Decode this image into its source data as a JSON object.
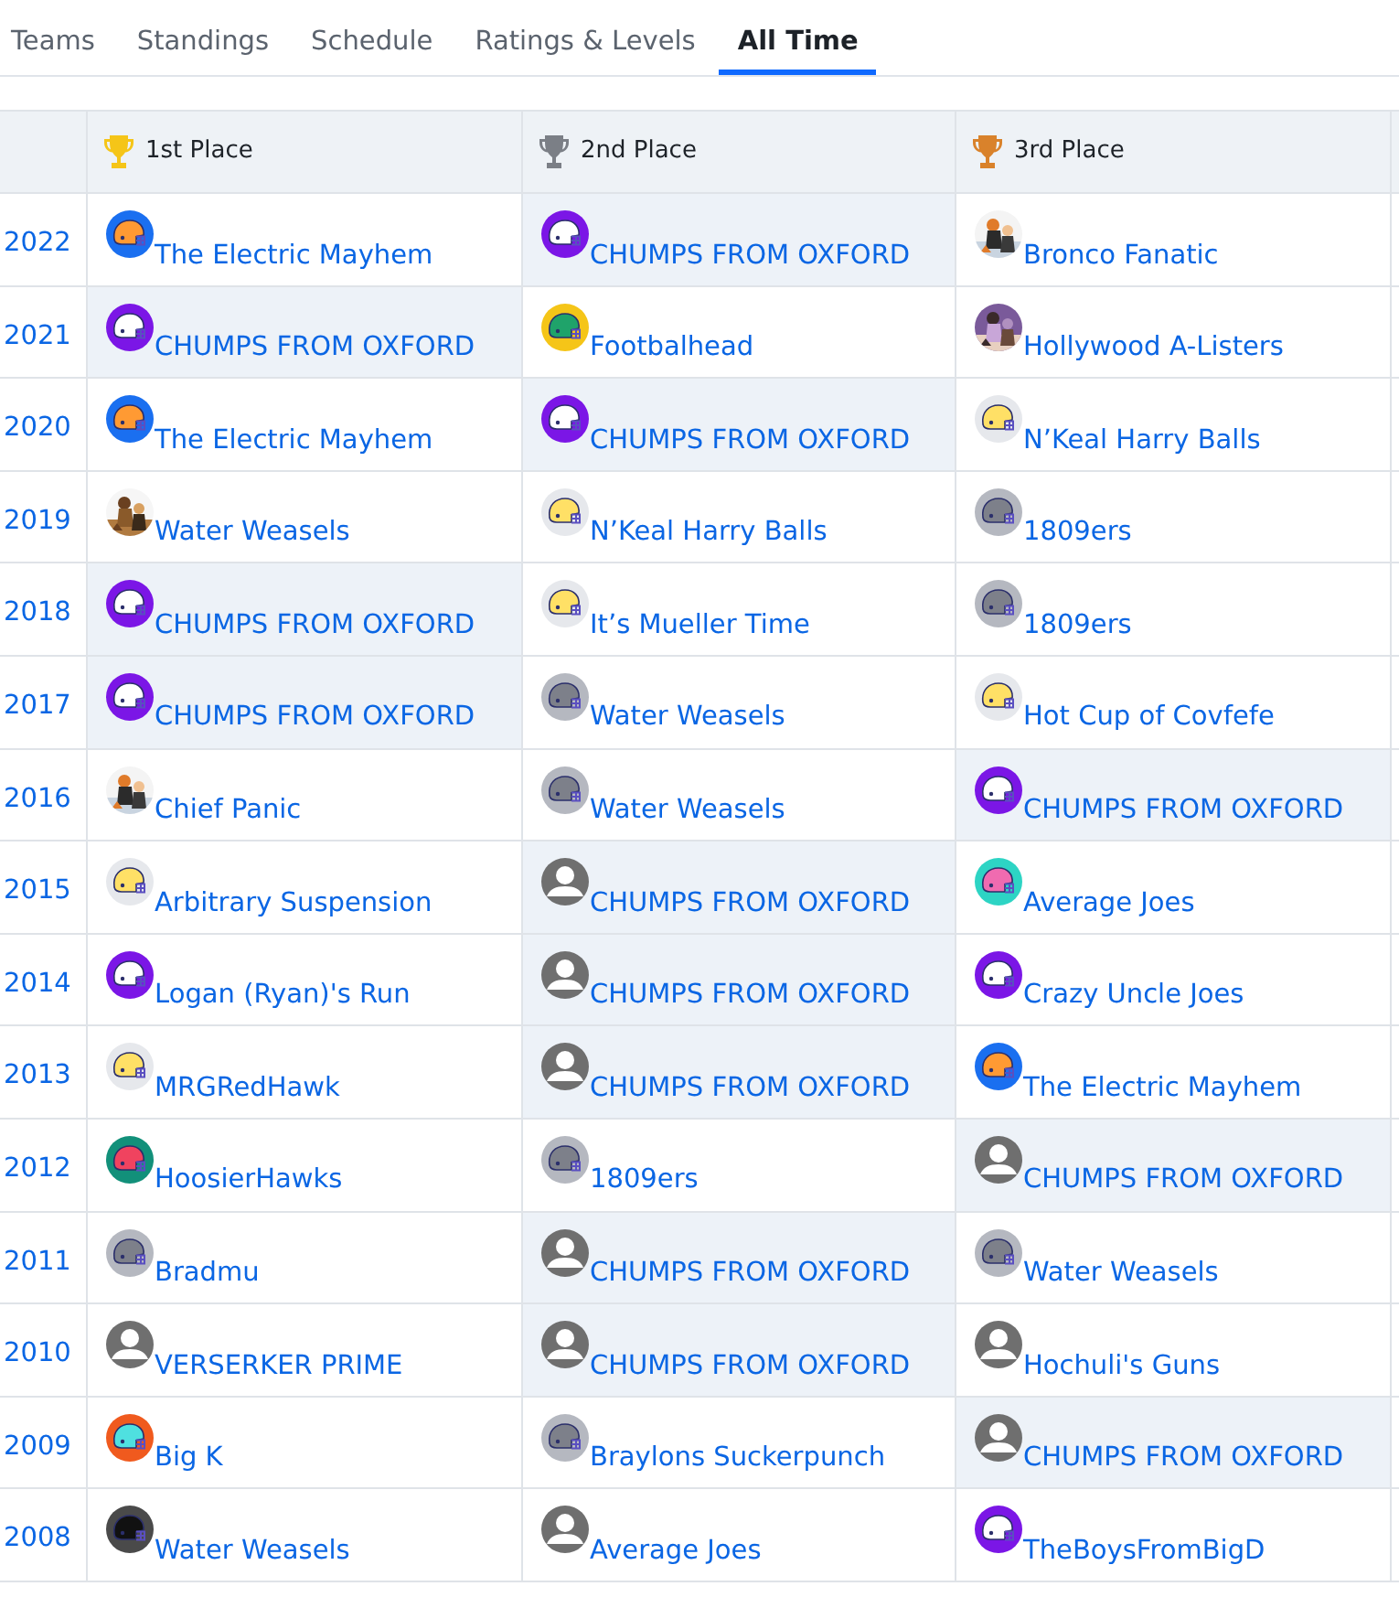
{
  "tabs": [
    {
      "label": "Teams",
      "selected": false
    },
    {
      "label": "Standings",
      "selected": false
    },
    {
      "label": "Schedule",
      "selected": false
    },
    {
      "label": "Ratings & Levels",
      "selected": false
    },
    {
      "label": "All Time",
      "selected": true
    }
  ],
  "table": {
    "columns": [
      {
        "label": "1st Place",
        "color": "#f5c518"
      },
      {
        "label": "2nd Place",
        "color": "#7b7f86"
      },
      {
        "label": "3rd Place",
        "color": "#d9822b"
      }
    ],
    "rows": [
      {
        "year": "2022",
        "cells": [
          {
            "team": "The Electric Mayhem",
            "highlighted": false,
            "avatar": {
              "kind": "helmet",
              "color": "#1a6ff0",
              "helmet": {
                "color": "#ff9a33"
              }
            }
          },
          {
            "team": "CHUMPS FROM OXFORD",
            "highlighted": true,
            "avatar": {
              "kind": "helmet",
              "color": "#7b16e6",
              "helmet": {
                "color": "#ffffff"
              }
            }
          },
          {
            "team": "Bronco Fanatic",
            "highlighted": false
          }
        ]
      },
      {
        "year": "2021",
        "cells": [
          {
            "team": "CHUMPS FROM OXFORD",
            "highlighted": true,
            "avatar": {
              "kind": "helmet",
              "color": "#7b16e6",
              "helmet": {
                "color": "#ffffff"
              }
            }
          },
          {
            "team": "Footbalhead",
            "highlighted": false,
            "avatar": {
              "kind": "helmet",
              "color": "#f5c518",
              "helmet": {
                "color": "#1fa36a"
              }
            }
          },
          {
            "team": "Hollywood A-Listers",
            "highlighted": false
          }
        ]
      },
      {
        "year": "2020",
        "cells": [
          {
            "team": "The Electric Mayhem",
            "highlighted": false,
            "avatar": {
              "kind": "helmet",
              "color": "#1a6ff0",
              "helmet": {
                "color": "#ff9a33"
              }
            }
          },
          {
            "team": "CHUMPS FROM OXFORD",
            "highlighted": true,
            "avatar": {
              "kind": "helmet",
              "color": "#7b16e6",
              "helmet": {
                "color": "#ffffff"
              }
            }
          },
          {
            "team": "N’Keal Harry Balls",
            "highlighted": false,
            "avatar": {
              "kind": "helmet",
              "color": "#e6e8ec",
              "helmet": {
                "color": "#ffe066"
              }
            }
          }
        ]
      },
      {
        "year": "2019",
        "cells": [
          {
            "team": "Water Weasels",
            "highlighted": false
          },
          {
            "team": "N’Keal Harry Balls",
            "highlighted": false,
            "avatar": {
              "kind": "helmet",
              "color": "#e6e8ec",
              "helmet": {
                "color": "#ffe066"
              }
            }
          },
          {
            "team": "1809ers",
            "highlighted": false,
            "avatar": {
              "kind": "helmet",
              "color": "#b5b8c0",
              "helmet": {
                "color": "#7d808a"
              }
            }
          }
        ]
      },
      {
        "year": "2018",
        "cells": [
          {
            "team": "CHUMPS FROM OXFORD",
            "highlighted": true,
            "avatar": {
              "kind": "helmet",
              "color": "#7b16e6",
              "helmet": {
                "color": "#ffffff"
              }
            }
          },
          {
            "team": "It’s Mueller Time",
            "highlighted": false,
            "avatar": {
              "kind": "helmet",
              "color": "#e6e8ec",
              "helmet": {
                "color": "#ffe066"
              }
            }
          },
          {
            "team": "1809ers",
            "highlighted": false,
            "avatar": {
              "kind": "helmet",
              "color": "#b5b8c0",
              "helmet": {
                "color": "#7d808a"
              }
            }
          }
        ]
      },
      {
        "year": "2017",
        "cells": [
          {
            "team": "CHUMPS FROM OXFORD",
            "highlighted": true,
            "avatar": {
              "kind": "helmet",
              "color": "#7b16e6",
              "helmet": {
                "color": "#ffffff"
              }
            }
          },
          {
            "team": "Water Weasels",
            "highlighted": false,
            "avatar": {
              "kind": "helmet",
              "color": "#b5b8c0",
              "helmet": {
                "color": "#7d808a"
              }
            }
          },
          {
            "team": "Hot Cup of Covfefe",
            "highlighted": false,
            "avatar": {
              "kind": "helmet",
              "color": "#e6e8ec",
              "helmet": {
                "color": "#ffe066"
              }
            }
          }
        ]
      },
      {
        "year": "2016",
        "cells": [
          {
            "team": "Chief Panic",
            "highlighted": false
          },
          {
            "team": "Water Weasels",
            "highlighted": false,
            "avatar": {
              "kind": "helmet",
              "color": "#b5b8c0",
              "helmet": {
                "color": "#7d808a"
              }
            }
          },
          {
            "team": "CHUMPS FROM OXFORD",
            "highlighted": true,
            "avatar": {
              "kind": "helmet",
              "color": "#7b16e6",
              "helmet": {
                "color": "#ffffff"
              }
            }
          }
        ]
      },
      {
        "year": "2015",
        "cells": [
          {
            "team": "Arbitrary Suspension",
            "highlighted": false,
            "avatar": {
              "kind": "helmet",
              "color": "#e6e8ec",
              "helmet": {
                "color": "#ffe066"
              }
            }
          },
          {
            "team": "CHUMPS FROM OXFORD",
            "highlighted": true,
            "avatar": {
              "kind": "person"
            }
          },
          {
            "team": "Average Joes",
            "highlighted": false,
            "avatar": {
              "kind": "helmet",
              "color": "#2dd4c4",
              "helmet": {
                "color": "#f06bb0"
              }
            }
          }
        ]
      },
      {
        "year": "2014",
        "cells": [
          {
            "team": "Logan (Ryan)'s Run",
            "highlighted": false,
            "avatar": {
              "kind": "helmet",
              "color": "#7b16e6",
              "helmet": {
                "color": "#ffffff"
              }
            }
          },
          {
            "team": "CHUMPS FROM OXFORD",
            "highlighted": true,
            "avatar": {
              "kind": "person"
            }
          },
          {
            "team": "Crazy Uncle Joes",
            "highlighted": false,
            "avatar": {
              "kind": "helmet",
              "color": "#7b16e6",
              "helmet": {
                "color": "#ffffff"
              }
            }
          }
        ]
      },
      {
        "year": "2013",
        "cells": [
          {
            "team": "MRGRedHawk",
            "highlighted": false,
            "avatar": {
              "kind": "helmet",
              "color": "#e6e8ec",
              "helmet": {
                "color": "#ffe066"
              }
            }
          },
          {
            "team": "CHUMPS FROM OXFORD",
            "highlighted": true,
            "avatar": {
              "kind": "person"
            }
          },
          {
            "team": "The Electric Mayhem",
            "highlighted": false,
            "avatar": {
              "kind": "helmet",
              "color": "#1a6ff0",
              "helmet": {
                "color": "#ff9a33"
              }
            }
          }
        ]
      },
      {
        "year": "2012",
        "cells": [
          {
            "team": "HoosierHawks",
            "highlighted": false,
            "avatar": {
              "kind": "helmet",
              "color": "#12907a",
              "helmet": {
                "color": "#f0435f"
              }
            }
          },
          {
            "team": "1809ers",
            "highlighted": false,
            "avatar": {
              "kind": "helmet",
              "color": "#b5b8c0",
              "helmet": {
                "color": "#7d808a"
              }
            }
          },
          {
            "team": "CHUMPS FROM OXFORD",
            "highlighted": true,
            "avatar": {
              "kind": "person"
            }
          }
        ]
      },
      {
        "year": "2011",
        "cells": [
          {
            "team": "Bradmu",
            "highlighted": false,
            "avatar": {
              "kind": "helmet",
              "color": "#b5b8c0",
              "helmet": {
                "color": "#7d808a"
              }
            }
          },
          {
            "team": "CHUMPS FROM OXFORD",
            "highlighted": true,
            "avatar": {
              "kind": "person"
            }
          },
          {
            "team": "Water Weasels",
            "highlighted": false,
            "avatar": {
              "kind": "helmet",
              "color": "#b5b8c0",
              "helmet": {
                "color": "#7d808a"
              }
            }
          }
        ]
      },
      {
        "year": "2010",
        "cells": [
          {
            "team": "VERSERKER PRIME",
            "highlighted": false,
            "avatar": {
              "kind": "person"
            }
          },
          {
            "team": "CHUMPS FROM OXFORD",
            "highlighted": true,
            "avatar": {
              "kind": "person"
            }
          },
          {
            "team": "Hochuli's Guns",
            "highlighted": false,
            "avatar": {
              "kind": "person"
            }
          }
        ]
      },
      {
        "year": "2009",
        "cells": [
          {
            "team": "Big K",
            "highlighted": false,
            "avatar": {
              "kind": "helmet",
              "color": "#f05a1e",
              "helmet": {
                "color": "#4fe0e0"
              }
            }
          },
          {
            "team": "Braylons Suckerpunch",
            "highlighted": false,
            "avatar": {
              "kind": "helmet",
              "color": "#b5b8c0",
              "helmet": {
                "color": "#7d808a"
              }
            }
          },
          {
            "team": "CHUMPS FROM OXFORD",
            "highlighted": true,
            "avatar": {
              "kind": "person"
            }
          }
        ]
      },
      {
        "year": "2008",
        "cells": [
          {
            "team": "Water Weasels",
            "highlighted": false,
            "avatar": {
              "kind": "helmet",
              "color": "#4a4a4a",
              "helmet": {
                "color": "#111111"
              }
            }
          },
          {
            "team": "Average Joes",
            "highlighted": false,
            "avatar": {
              "kind": "person"
            }
          },
          {
            "team": "TheBoysFromBigD",
            "highlighted": false,
            "avatar": {
              "kind": "helmet",
              "color": "#7b16e6",
              "helmet": {
                "color": "#ffffff"
              }
            }
          }
        ]
      }
    ]
  }
}
